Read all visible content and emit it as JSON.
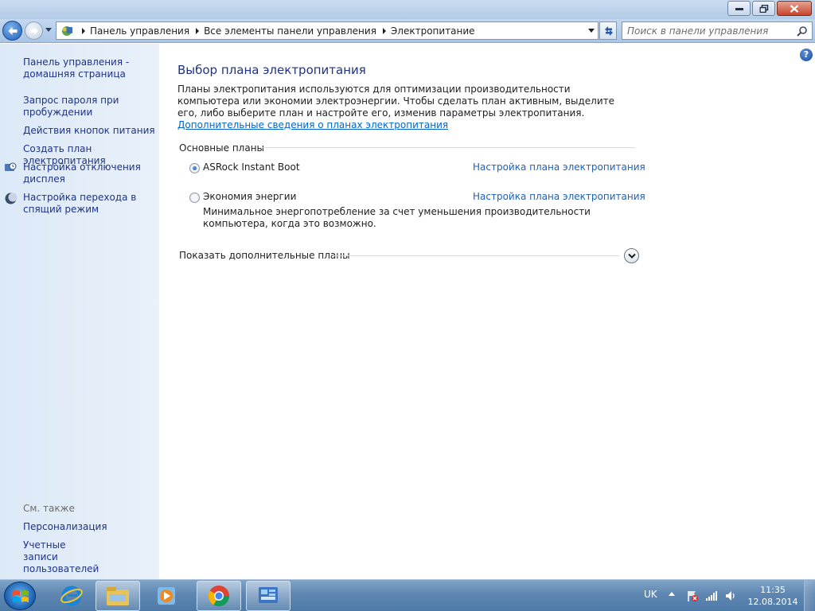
{
  "window": {
    "caption": {
      "minimize_icon": "minimize-icon",
      "maximize_icon": "restore-icon",
      "close_icon": "close-icon"
    }
  },
  "navigation": {
    "breadcrumbs": [
      "Панель управления",
      "Все элементы панели управления",
      "Электропитание"
    ],
    "search_placeholder": "Поиск в панели управления"
  },
  "sidebar": {
    "links": [
      "Панель управления - домашняя страница",
      "Запрос пароля при пробуждении",
      "Действия кнопок питания",
      "Создать план электропитания",
      "Настройка отключения дисплея",
      "Настройка перехода в спящий режим"
    ],
    "see_also_label": "См. также",
    "see_also_links": [
      "Персонализация",
      "Учетные записи пользователей"
    ]
  },
  "main": {
    "title": "Выбор плана электропитания",
    "intro_text": "Планы электропитания используются для оптимизации производительности компьютера или экономии электроэнергии. Чтобы сделать план активным, выделите его, либо выберите план и настройте его, изменив параметры электропитания.",
    "intro_link": "Дополнительные сведения о планах электропитания",
    "group_header": "Основные планы",
    "plans": [
      {
        "name": "ASRock Instant Boot",
        "link": "Настройка плана электропитания",
        "selected": true
      },
      {
        "name": "Экономия энергии",
        "link": "Настройка плана электропитания",
        "selected": false,
        "description": "Минимальное энергопотребление за счет уменьшения производительности компьютера, когда это возможно."
      }
    ],
    "show_more": "Показать дополнительные планы"
  },
  "taskbar": {
    "language": "UK",
    "time": "11:35",
    "date": "12.08.2014",
    "pinned": [
      "internet-explorer-icon",
      "windows-explorer-icon",
      "media-player-icon",
      "chrome-icon",
      "control-panel-icon"
    ]
  }
}
